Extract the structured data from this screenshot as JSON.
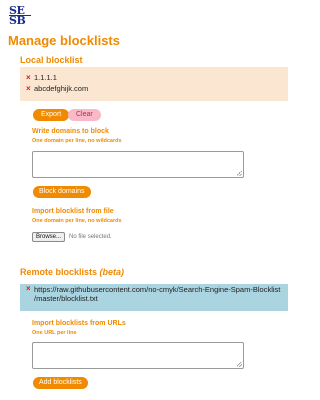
{
  "logo": {
    "line1": "SE",
    "line2": "SB"
  },
  "page_title": "Manage blocklists",
  "local": {
    "heading": "Local blocklist",
    "entries": [
      "1.1.1.1",
      "abcdefghijk.com"
    ],
    "remove_glyph": "×",
    "export_label": "Export",
    "clear_label": "Clear"
  },
  "write": {
    "label": "Write domains to block",
    "sublabel": "One domain per line, no wildcards",
    "textarea_value": "",
    "button_label": "Block domains"
  },
  "import_file": {
    "label": "Import blocklist from file",
    "sublabel": "One domain per line, no wildcards",
    "browse_label": "Browse...",
    "no_file": "No file selected."
  },
  "remote": {
    "heading_main": "Remote blocklists",
    "heading_beta": "(beta)",
    "entry_line1": "https://raw.githubusercontent.com/no-cmyk/Search-Engine-Spam-Blocklist",
    "entry_line2": "/master/blocklist.txt"
  },
  "import_urls": {
    "label": "Import blocklists from URLs",
    "sublabel": "One URL per line",
    "textarea_value": "",
    "button_label": "Add blocklists"
  },
  "colors": {
    "accent": "#f08a00",
    "local_bg": "#fbe7d1",
    "remote_bg": "#a9d4e0",
    "remove": "#d21f1f"
  }
}
